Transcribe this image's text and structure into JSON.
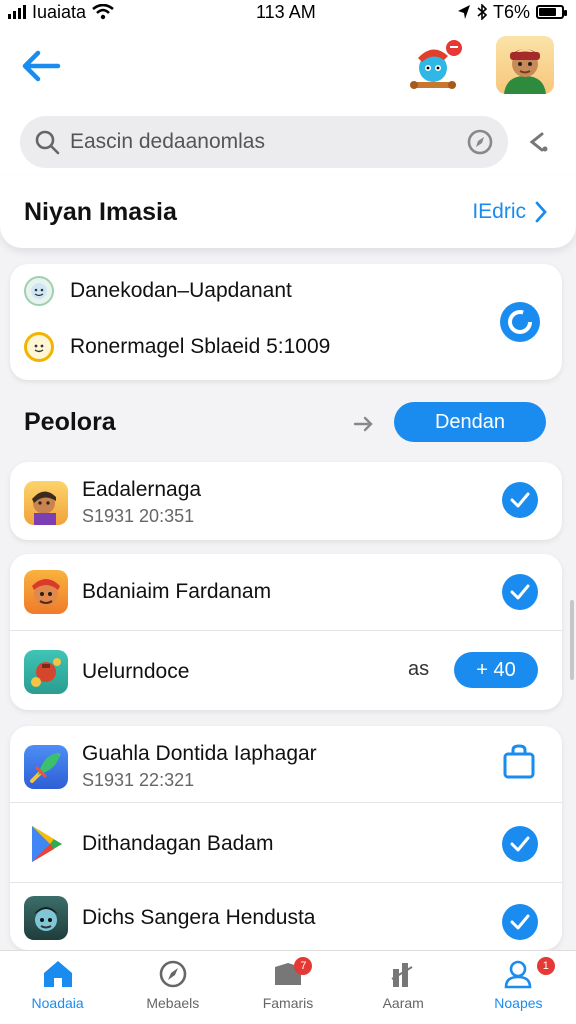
{
  "status_bar": {
    "carrier": "Iuaiata",
    "time": "113 AM",
    "battery": "T6%"
  },
  "search": {
    "placeholder": "Eascin dedaanomlas"
  },
  "header": {
    "title": "Niyan Imasia",
    "edit_label": "IEdric"
  },
  "info": {
    "line1": "Danekodan–Uapdanant",
    "line2": "Ronermagel Sblaeid 5:1009"
  },
  "section": {
    "title": "Peolora",
    "button_label": "Dendan"
  },
  "apps": [
    {
      "name": "Eadalernaga",
      "sub": "S1931 20:351"
    },
    {
      "name": "Bdaniaim Fardanam"
    },
    {
      "name": "Uelurndoce",
      "count": "as",
      "pill": "+ 40"
    },
    {
      "name": "Guahla Dontida Iaphagar",
      "sub": "S1931 22:321"
    },
    {
      "name": "Dithandagan Badam"
    },
    {
      "name": "Dichs Sangera Hendusta"
    }
  ],
  "tabs": [
    {
      "label": "Noadaia",
      "badge": ""
    },
    {
      "label": "Mebaels",
      "badge": ""
    },
    {
      "label": "Famaris",
      "badge": "7"
    },
    {
      "label": "Aaram",
      "badge": ""
    },
    {
      "label": "Noapes",
      "badge": "1"
    }
  ],
  "colors": {
    "accent": "#1a8cf0",
    "badge": "#e53935"
  }
}
